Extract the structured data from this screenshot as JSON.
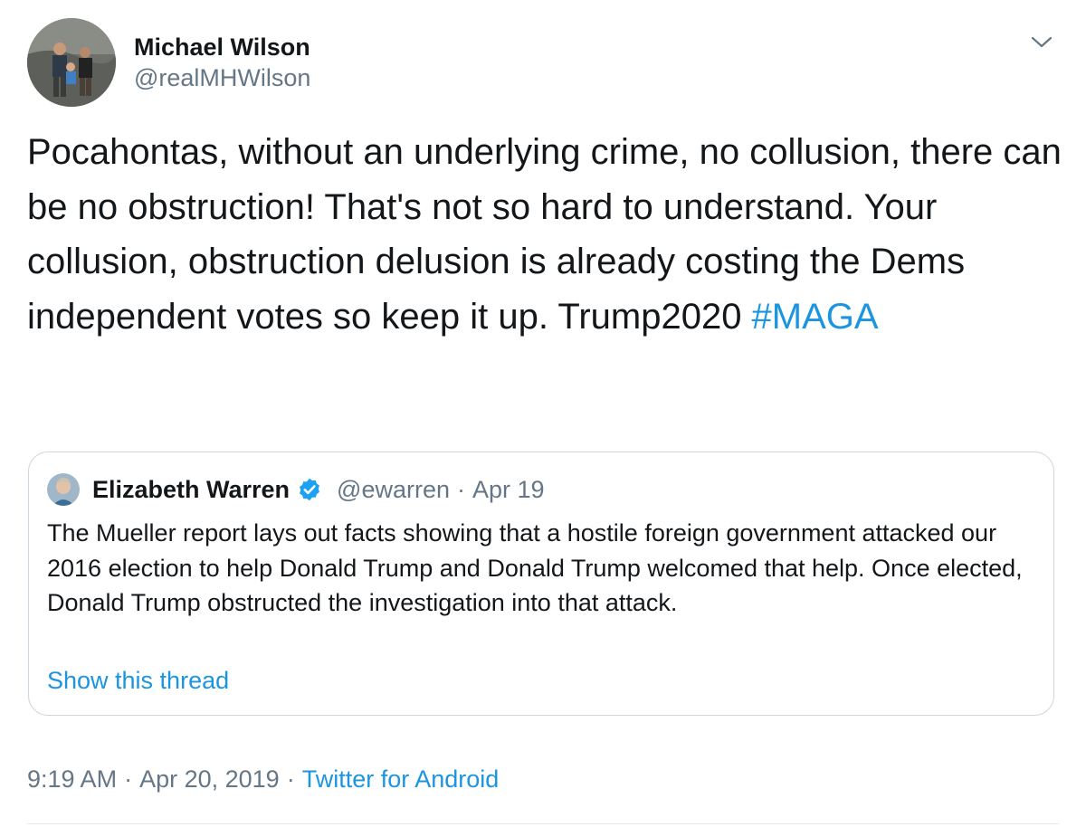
{
  "tweet": {
    "author": {
      "display_name": "Michael Wilson",
      "handle": "@realMHWilson",
      "avatar_icon": "profile-photo"
    },
    "text_main": "Pocahontas, without an underlying crime, no collusion, there can be no obstruction! That's not so hard to understand. Your collusion, obstruction delusion is already costing the Dems independent votes so keep it up. Trump2020 ",
    "hashtag": "#MAGA",
    "quoted_tweet": {
      "author": {
        "display_name": "Elizabeth Warren",
        "verified": true,
        "handle": "@ewarren",
        "avatar_icon": "profile-photo"
      },
      "separator": "·",
      "date": "Apr 19",
      "text": "The Mueller report lays out facts showing that a hostile foreign government attacked our 2016 election to help Donald Trump and Donald Trump welcomed that help. Once elected, Donald Trump obstructed the investigation into that attack.",
      "show_thread_label": "Show this thread"
    },
    "time": "9:19 AM",
    "separator": "·",
    "date": "Apr 20, 2019",
    "source": "Twitter for Android"
  },
  "colors": {
    "link": "#1b95e0",
    "secondary_text": "#657786",
    "primary_text": "#14171a",
    "border": "#ccd6dd"
  },
  "icons": {
    "menu": "chevron-down-icon",
    "verified": "verified-badge-icon"
  }
}
